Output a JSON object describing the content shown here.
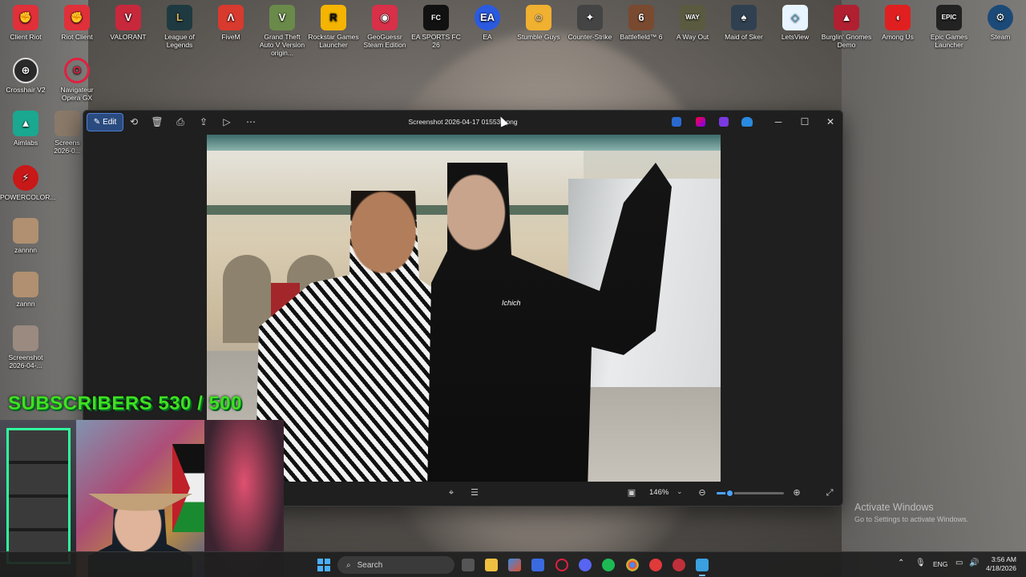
{
  "desktop": {
    "top_icons": [
      {
        "label": "Client Riot",
        "icon": "riot-fist-icon",
        "color": "#e0303a"
      },
      {
        "label": "Riot Client",
        "icon": "riot-fist-icon",
        "color": "#e0303a"
      },
      {
        "label": "VALORANT",
        "icon": "valorant-icon",
        "color": "#c8283c"
      },
      {
        "label": "League of Legends",
        "icon": "league-icon",
        "color": "#1e3a40"
      },
      {
        "label": "FiveM",
        "icon": "fivem-icon",
        "color": "#d83a2e"
      },
      {
        "label": "Grand Theft Auto V Version origin...",
        "icon": "gta-icon",
        "color": "#6a8a4a"
      },
      {
        "label": "Rockstar Games Launcher",
        "icon": "rockstar-icon",
        "color": "#f4b400"
      },
      {
        "label": "GeoGuessr Steam Edition",
        "icon": "map-pin-icon",
        "color": "#d83048"
      },
      {
        "label": "EA SPORTS FC 26",
        "icon": "fc26-icon",
        "color": "#111111"
      },
      {
        "label": "EA",
        "icon": "ea-icon",
        "color": "#2a5ae0"
      },
      {
        "label": "Stumble Guys",
        "icon": "stumble-icon",
        "color": "#f0b030"
      },
      {
        "label": "Counter-Strike",
        "icon": "counter-strike-icon",
        "color": "#444444"
      },
      {
        "label": "Battlefield™ 6",
        "icon": "battlefield-icon",
        "color": "#7a4a30"
      },
      {
        "label": "A Way Out",
        "icon": "a-way-out-icon",
        "color": "#5a5a40"
      },
      {
        "label": "Maid of Sker",
        "icon": "maid-of-sker-icon",
        "color": "#304050"
      },
      {
        "label": "LetsView",
        "icon": "letsview-icon",
        "color": "#e8f4ff"
      },
      {
        "label": "Burglin' Gnomes Demo",
        "icon": "gnome-icon",
        "color": "#b02030"
      },
      {
        "label": "Among Us",
        "icon": "among-us-icon",
        "color": "#e02020"
      },
      {
        "label": "Epic Games Launcher",
        "icon": "epic-games-icon",
        "color": "#222222"
      },
      {
        "label": "Steam",
        "icon": "steam-icon",
        "color": "#1b4a78"
      }
    ],
    "left_icons": [
      {
        "label": "Crosshair V2",
        "icon": "crosshair-icon",
        "color": "#2a2a2a"
      },
      {
        "label": "Navigateur Opera GX",
        "icon": "opera-gx-icon",
        "color": "#e02040"
      },
      {
        "label": "Aimlabs",
        "icon": "aimlabs-icon",
        "color": "#1aa890"
      },
      {
        "label": "Screens 2026-0...",
        "icon": "image-file-icon",
        "color": "#8a7a6a"
      },
      {
        "label": "POWERCOLOR...",
        "icon": "powercolor-icon",
        "color": "#c81818"
      },
      {
        "label": "zannnn",
        "icon": "image-file-icon",
        "color": "#b09070"
      },
      {
        "label": "zannn",
        "icon": "image-file-icon",
        "color": "#b09070"
      },
      {
        "label": "Screenshot 2026-04-...",
        "icon": "image-file-icon",
        "color": "#9a8a80"
      }
    ]
  },
  "photos_window": {
    "edit_label": "Edit",
    "title": "Screenshot 2026-04-17 015530.png",
    "shirt_text": "Ichich",
    "zoom": "146%",
    "zoom_fraction": 0.19
  },
  "overlay": {
    "subscribers_text": "SUBSCRIBERS 530 / 500"
  },
  "watermark": {
    "line1": "Activate Windows",
    "line2": "Go to Settings to activate Windows."
  },
  "taskbar": {
    "search_label": "Search",
    "language": "ENG",
    "time": "3:56 AM",
    "date": "4/18/2026"
  }
}
